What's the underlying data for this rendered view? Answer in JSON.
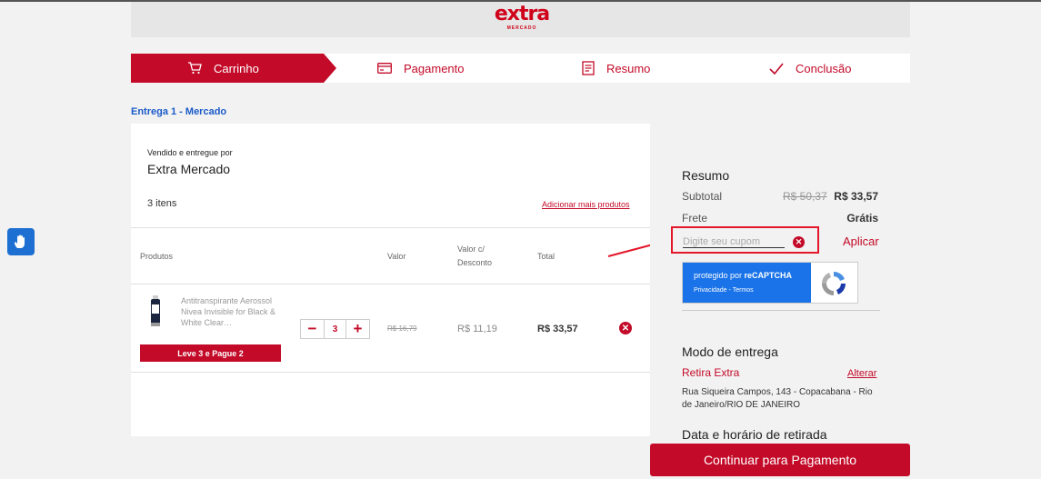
{
  "brand": {
    "logo_text": "extra",
    "logo_sub": "MERCADO",
    "accent": "#c30a28",
    "link_blue": "#1a5ac8"
  },
  "steps": [
    {
      "label": "Carrinho",
      "icon": "cart-icon",
      "active": true
    },
    {
      "label": "Pagamento",
      "icon": "card-icon",
      "active": false
    },
    {
      "label": "Resumo",
      "icon": "receipt-icon",
      "active": false
    },
    {
      "label": "Conclusão",
      "icon": "check-icon",
      "active": false
    }
  ],
  "delivery": {
    "title": "Entrega 1 - Mercado"
  },
  "cart": {
    "seller_label": "Vendido e entregue por",
    "seller_name": "Extra Mercado",
    "item_count": "3 itens",
    "add_more": "Adicionar mais produtos",
    "columns": {
      "products": "Produtos",
      "value": "Valor",
      "discount_value": "Valor c/ Desconto",
      "total": "Total"
    },
    "items": [
      {
        "name": "Antitranspirante Aerossol Nivea Invisible for Black & White Clear…",
        "quantity": "3",
        "old_price": "R$ 16,79",
        "discount_price": "R$ 11,19",
        "total": "R$ 33,57",
        "promo": "Leve 3 e Pague 2"
      }
    ]
  },
  "summary": {
    "title": "Resumo",
    "subtotal_label": "Subtotal",
    "subtotal_old": "R$ 50,37",
    "subtotal_value": "R$ 33,57",
    "shipping_label": "Frete",
    "shipping_value": "Grátis",
    "coupon_placeholder": "Digite seu cupom",
    "apply_label": "Aplicar",
    "recaptcha": {
      "line1_prefix": "protegido por ",
      "line1_brand": "reCAPTCHA",
      "privacy": "Privacidade",
      "sep": " - ",
      "terms": "Termos"
    }
  },
  "delivery_mode": {
    "title": "Modo de entrega",
    "name": "Retira Extra",
    "alter_label": "Alterar",
    "address": "Rua Siqueira Campos, 143 - Copacabana - Rio de Janeiro/RIO DE JANEIRO",
    "date_title": "Data e horário de retirada"
  },
  "continue_label": "Continuar para Pagamento"
}
